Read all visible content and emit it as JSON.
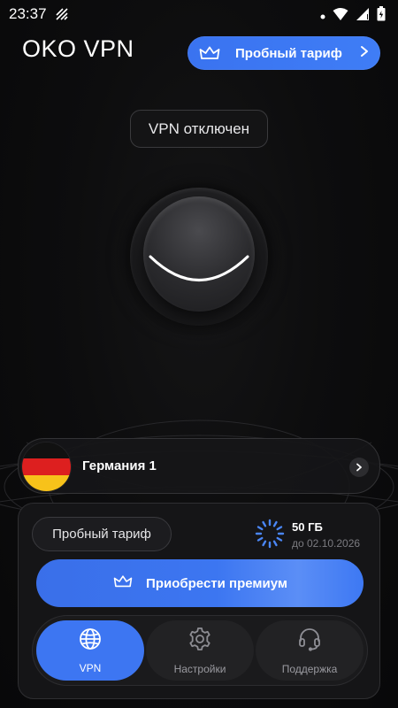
{
  "status_bar": {
    "time": "23:37"
  },
  "header": {
    "app_title": "OKO VPN",
    "trial_button_label": "Пробный тариф"
  },
  "connection": {
    "status_text": "VPN отключен",
    "connected": false
  },
  "server": {
    "name": "Германия 1",
    "flag_colors": [
      "#111111",
      "#dd1f1f",
      "#f7c21a"
    ]
  },
  "plan": {
    "name": "Пробный тариф",
    "traffic_amount": "50 ГБ",
    "valid_until": "до 02.10.2026"
  },
  "actions": {
    "buy_premium_label": "Приобрести премиум"
  },
  "nav": {
    "items": [
      {
        "label": "VPN",
        "icon": "globe-icon",
        "active": true
      },
      {
        "label": "Настройки",
        "icon": "gear-icon",
        "active": false
      },
      {
        "label": "Поддержка",
        "icon": "headset-icon",
        "active": false
      }
    ]
  },
  "colors": {
    "accent": "#3d76f2",
    "background": "#0b0b0c",
    "panel": "#151517"
  }
}
